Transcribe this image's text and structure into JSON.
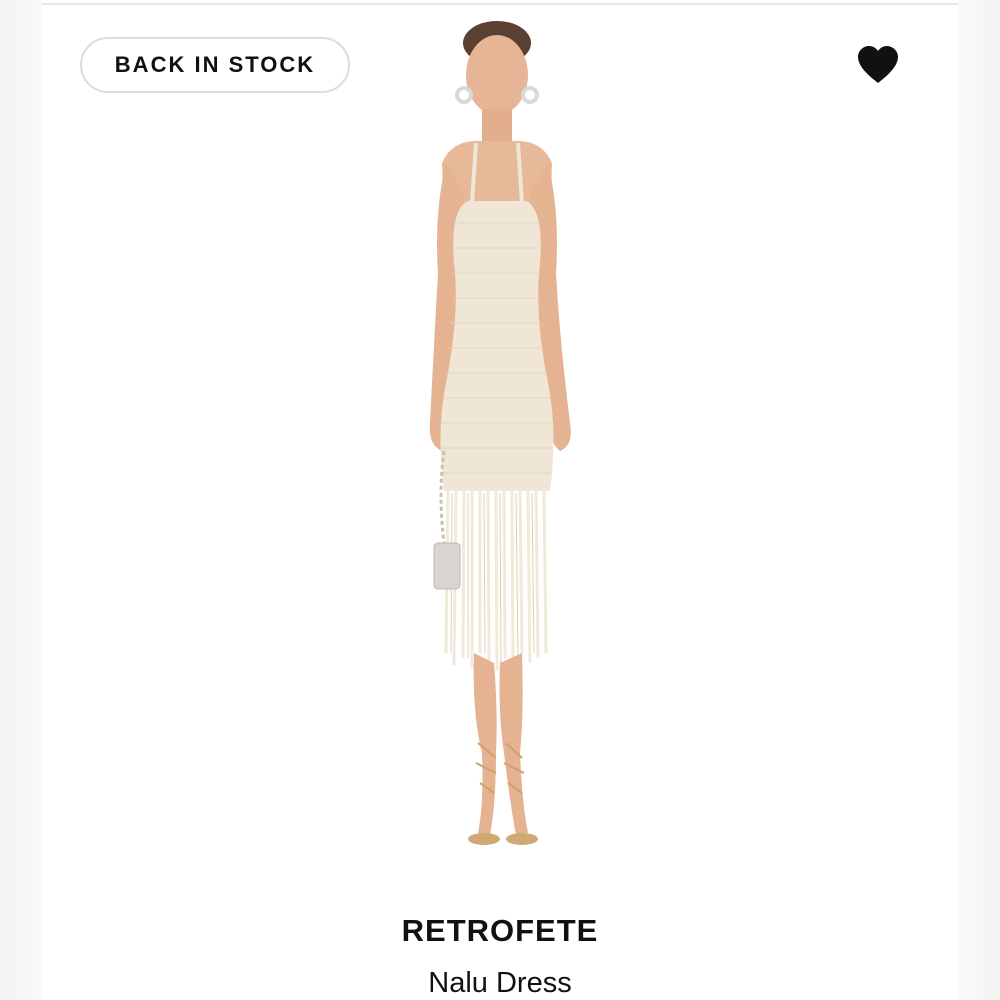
{
  "badge": {
    "label": "BACK IN STOCK"
  },
  "favorite": {
    "icon": "heart-icon",
    "state": "favorited",
    "color": "#111111"
  },
  "product": {
    "brand": "RETROFETE",
    "name": "Nalu Dress",
    "image_icon": "dress-model-image"
  },
  "colors": {
    "background": "#ffffff",
    "dress": "#efe6d6",
    "fringe": "#f1e9da",
    "skin": "#e8b998",
    "text": "#111111"
  }
}
